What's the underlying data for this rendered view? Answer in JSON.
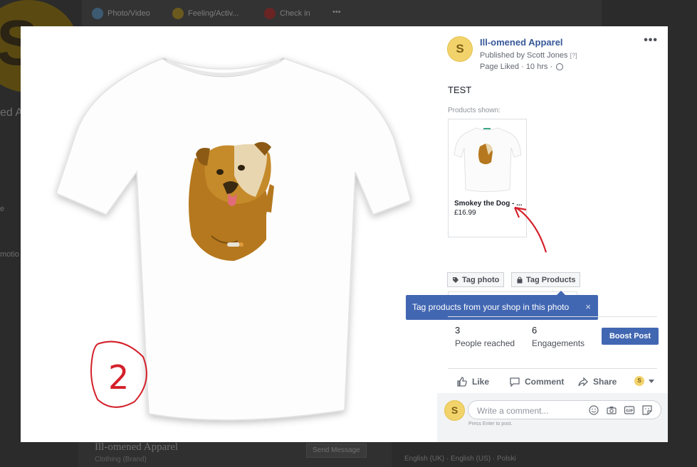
{
  "background": {
    "composer_actions": [
      "Photo/Video",
      "Feeling/Activ...",
      "Check in"
    ],
    "page_title": "Ill-omened Apparel",
    "page_category": "Clothing (Brand)",
    "send_message_label": "Send Message",
    "side_fragments": [
      "ed A",
      "e",
      "motio"
    ],
    "language_links": "English (UK) · English (US) · Polski"
  },
  "post": {
    "page_name": "Ill-omened Apparel",
    "avatar_letter": "S",
    "published_by": "Published by Scott Jones",
    "published_q": "[?]",
    "meta": "Page Liked · 10 hrs ·",
    "text": "TEST",
    "products_label": "Products shown:",
    "product": {
      "name": "Smokey the Dog - ...",
      "price": "£16.99"
    },
    "tag_photo_label": "Tag photo",
    "tag_products_label": "Tag Products",
    "tooltip_text": "Tag products from your shop in this photo",
    "tooltip_close": "×",
    "reached_count": "3",
    "reached_label": "People reached",
    "engagements_count": "6",
    "engagements_label": "Engagements",
    "boost_label": "Boost Post",
    "like_label": "Like",
    "comment_label": "Comment",
    "share_label": "Share",
    "comment_placeholder": "Write a comment...",
    "press_enter": "Press Enter to post.",
    "annotation_number": "2"
  },
  "colors": {
    "link_blue": "#365899",
    "facebook_blue": "#4267b2",
    "annotation_red": "#d4202a"
  },
  "icons": [
    "more-icon",
    "globe-icon",
    "tag-icon",
    "shopping-bag-icon",
    "close-icon",
    "thumbs-up-icon",
    "comment-bubble-icon",
    "share-arrow-icon",
    "caret-down-icon",
    "emoji-icon",
    "camera-icon",
    "gif-icon",
    "sticker-icon"
  ]
}
